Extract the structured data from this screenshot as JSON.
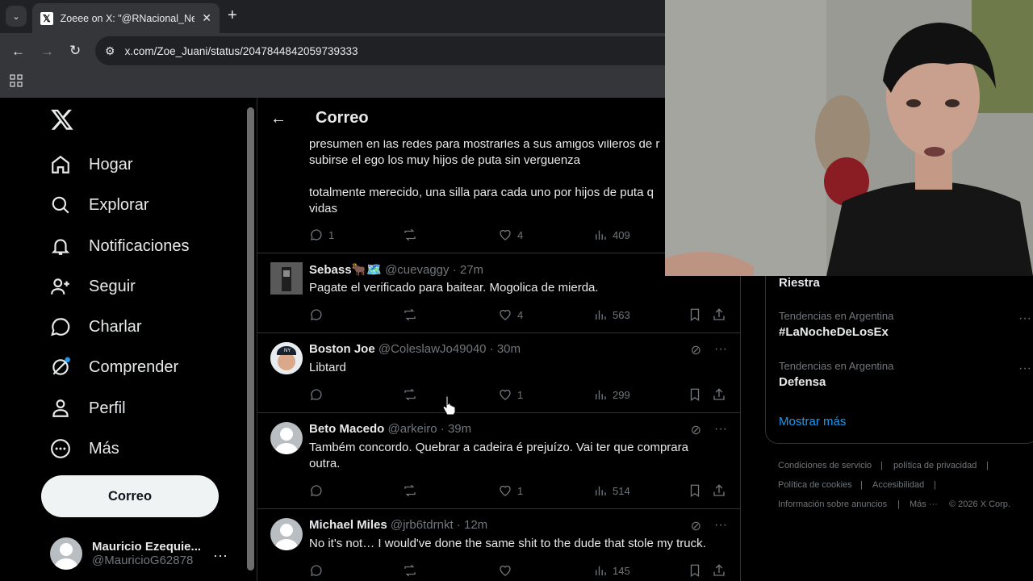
{
  "browser": {
    "tab_title": "Zoeee on X: \"@RNacional_New",
    "url": "x.com/Zoe_Juani/status/2047844842059739333"
  },
  "leftnav": {
    "items": [
      {
        "label": "Hogar",
        "icon": "home-icon"
      },
      {
        "label": "Explorar",
        "icon": "search-icon"
      },
      {
        "label": "Notificaciones",
        "icon": "bell-icon"
      },
      {
        "label": "Seguir",
        "icon": "follow-icon"
      },
      {
        "label": "Charlar",
        "icon": "chat-icon"
      },
      {
        "label": "Comprender",
        "icon": "grok-icon"
      },
      {
        "label": "Perfil",
        "icon": "person-icon"
      },
      {
        "label": "Más",
        "icon": "more-circle-icon"
      }
    ],
    "post_button": "Correo",
    "account": {
      "name": "Mauricio Ezequie...",
      "handle": "@MauricioG62878"
    }
  },
  "main": {
    "header_title": "Correo",
    "main_post": {
      "lines": [
        "presumen en las redes para mostrarles a sus amigos villeros de r",
        "subirse el ego los muy hijos de puta sin verguenza",
        "",
        "totalmente merecido, una silla para cada uno por hijos de puta q",
        "vidas"
      ],
      "replies": "1",
      "likes": "4",
      "views": "409"
    },
    "replies": [
      {
        "name": "Sebass🐂🗺️",
        "handle": "@cuevaggy",
        "time": "· 27m",
        "text": "Pagate el verificado para baitear. Mogolica de mierda.",
        "replies": "",
        "likes": "4",
        "views": "563"
      },
      {
        "name": "Boston Joe",
        "handle": "@ColeslawJo49040",
        "time": "· 30m",
        "text": "Libtard",
        "replies": "",
        "likes": "1",
        "views": "299"
      },
      {
        "name": "Beto Macedo",
        "handle": "@arkeiro",
        "time": "· 39m",
        "text": "Também concordo. Quebrar a cadeira é prejuízo. Vai ter que comprara outra.",
        "replies": "",
        "likes": "1",
        "views": "514"
      },
      {
        "name": "Michael Miles",
        "handle": "@jrb6tdrnkt",
        "time": "· 12m",
        "text": "No it's not… I would've done the same shit to the dude that stole my truck.",
        "replies": "",
        "likes": "",
        "views": "145"
      }
    ]
  },
  "right": {
    "trends": [
      {
        "context": "",
        "name": "Riestra"
      },
      {
        "context": "Tendencias en Argentina",
        "name": "#LaNocheDeLosEx"
      },
      {
        "context": "Tendencias en Argentina",
        "name": "Defensa"
      }
    ],
    "show_more": "Mostrar más",
    "footer": {
      "terms": "Condiciones de servicio",
      "privacy": "política de privacidad",
      "cookies": "Política de cookies",
      "accessibility": "Accesibilidad",
      "ads": "Información sobre anuncios",
      "more": "Más ···",
      "copyright": "© 2026 X Corp."
    }
  },
  "colors": {
    "accent": "#1d9bf0",
    "muted": "#71767b",
    "border": "#2f3336"
  }
}
